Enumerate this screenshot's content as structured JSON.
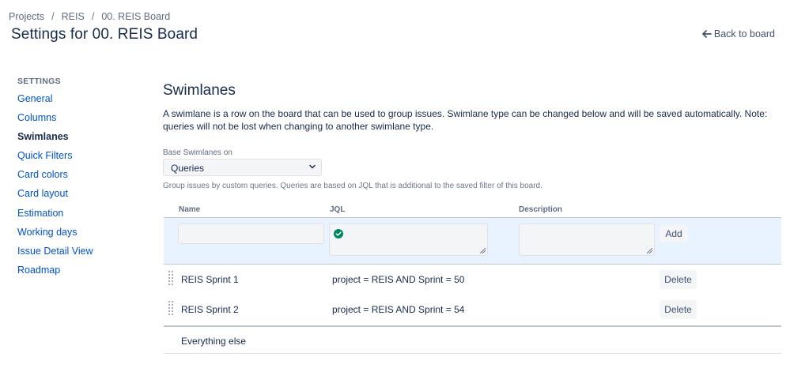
{
  "breadcrumb": [
    "Projects",
    "REIS",
    "00. REIS Board"
  ],
  "page_title": "Settings for 00. REIS Board",
  "back_link": "Back to board",
  "sidebar": {
    "heading": "SETTINGS",
    "items": [
      {
        "label": "General",
        "active": false
      },
      {
        "label": "Columns",
        "active": false
      },
      {
        "label": "Swimlanes",
        "active": true
      },
      {
        "label": "Quick Filters",
        "active": false
      },
      {
        "label": "Card colors",
        "active": false
      },
      {
        "label": "Card layout",
        "active": false
      },
      {
        "label": "Estimation",
        "active": false
      },
      {
        "label": "Working days",
        "active": false
      },
      {
        "label": "Issue Detail View",
        "active": false
      },
      {
        "label": "Roadmap",
        "active": false
      }
    ]
  },
  "main": {
    "title": "Swimlanes",
    "description": "A swimlane is a row on the board that can be used to group issues. Swimlane type can be changed below and will be saved automatically. Note: queries will not be lost when changing to another swimlane type.",
    "base_label": "Base Swimlanes on",
    "base_value": "Queries",
    "help_text": "Group issues by custom queries. Queries are based on JQL that is additional to the saved filter of this board."
  },
  "table": {
    "headers": {
      "name": "Name",
      "jql": "JQL",
      "description": "Description"
    },
    "add_label": "Add",
    "rows": [
      {
        "name": "REIS Sprint 1",
        "jql": "project = REIS AND Sprint = 50",
        "action": "Delete"
      },
      {
        "name": "REIS Sprint 2",
        "jql": "project = REIS AND Sprint = 54",
        "action": "Delete"
      }
    ],
    "everything_else": "Everything else"
  },
  "colors": {
    "link": "#0052cc",
    "text": "#172b4d",
    "add_row_bg": "#e9f2ff",
    "valid_green": "#00875a"
  }
}
